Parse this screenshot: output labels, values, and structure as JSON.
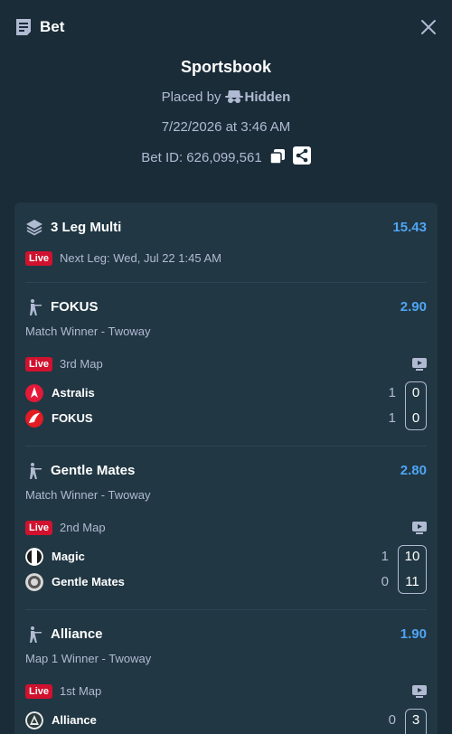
{
  "header": {
    "title": "Bet",
    "close_icon": "close-icon",
    "receipt_icon": "receipt-icon"
  },
  "summary": {
    "book": "Sportsbook",
    "placed_by_label": "Placed by",
    "placed_by_user": "Hidden",
    "date": "7/22/2026 at 3:46 AM",
    "bet_id": "Bet ID: 626,099,561"
  },
  "multi": {
    "title": "3 Leg Multi",
    "odds": "15.43",
    "live": "Live",
    "next_leg": "Next Leg: Wed, Jul 22 1:45 AM"
  },
  "legs": [
    {
      "team": "FOKUS",
      "odds": "2.90",
      "market": "Match Winner - Twoway",
      "live": "Live",
      "status": "3rd Map",
      "teams": [
        {
          "name": "Astralis",
          "map_score": "1",
          "round_score": "0"
        },
        {
          "name": "FOKUS",
          "map_score": "1",
          "round_score": "0"
        }
      ]
    },
    {
      "team": "Gentle Mates",
      "odds": "2.80",
      "market": "Match Winner - Twoway",
      "live": "Live",
      "status": "2nd Map",
      "teams": [
        {
          "name": "Magic",
          "map_score": "1",
          "round_score": "10"
        },
        {
          "name": "Gentle Mates",
          "map_score": "0",
          "round_score": "11"
        }
      ]
    },
    {
      "team": "Alliance",
      "odds": "1.90",
      "market": "Map 1 Winner - Twoway",
      "live": "Live",
      "status": "1st Map",
      "teams": [
        {
          "name": "Alliance",
          "map_score": "0",
          "round_score": "3"
        }
      ]
    }
  ],
  "colors": {
    "background": "#1a2c38",
    "card": "#213743",
    "odds": "#4fa5f5",
    "live": "#d0122e",
    "muted": "#b1bad3"
  }
}
